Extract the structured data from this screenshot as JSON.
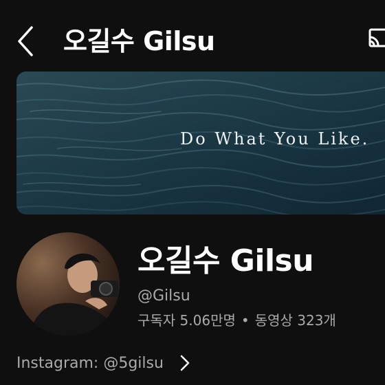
{
  "header": {
    "title": "오길수 Gilsu",
    "back_icon": "chevron-left-icon",
    "cast_icon": "cast-icon"
  },
  "banner": {
    "text": "Do What You Like."
  },
  "channel": {
    "name": "오길수 Gilsu",
    "handle": "@Gilsu",
    "subscribers": "구독자 5.06만명",
    "separator": "•",
    "videos": "동영상 323개"
  },
  "links": {
    "primary": "Instagram: @5gilsu",
    "more_icon": "chevron-right-icon"
  },
  "colors": {
    "background": "#0f0f0f",
    "text_primary": "#ffffff",
    "text_secondary": "#aaaaaa"
  }
}
